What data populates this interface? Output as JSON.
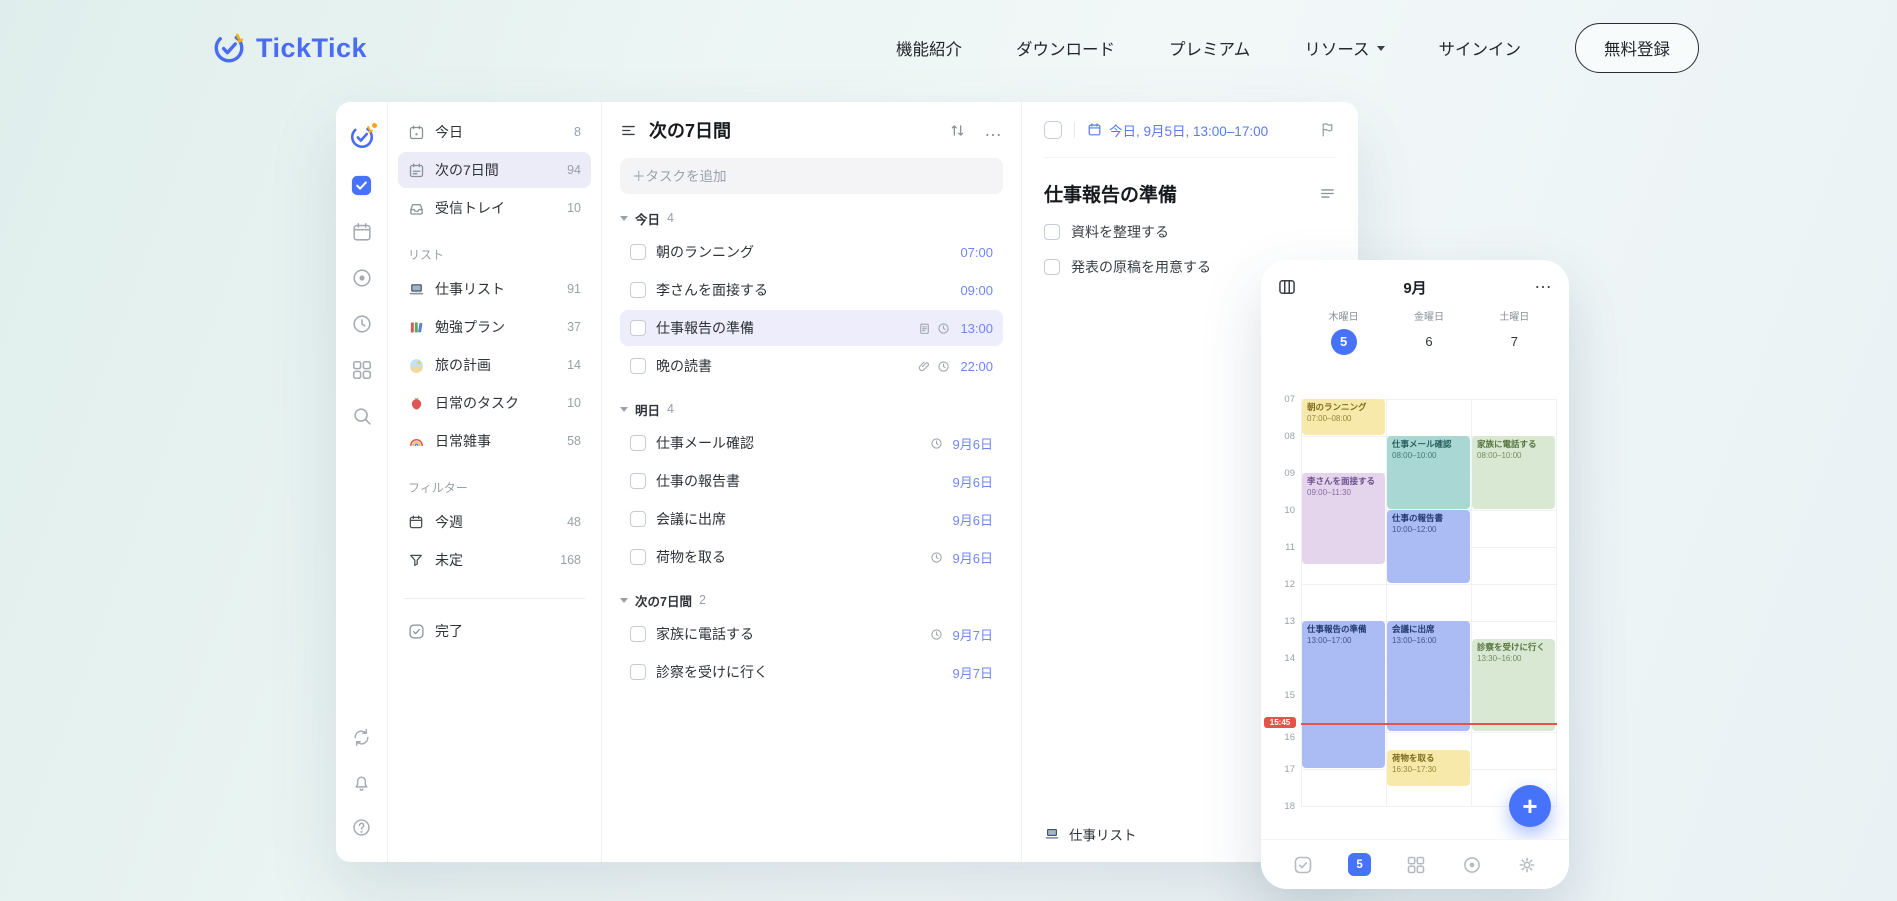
{
  "brand": {
    "name": "TickTick"
  },
  "nav": {
    "items": [
      {
        "label": "機能紹介"
      },
      {
        "label": "ダウンロード"
      },
      {
        "label": "プレミアム"
      },
      {
        "label": "リソース"
      },
      {
        "label": "サインイン"
      }
    ],
    "cta": "無料登録"
  },
  "icons": {
    "ellipsis": "…",
    "plus": "+"
  },
  "sidebar": {
    "smart_lists": [
      {
        "label": "今日",
        "count": "8"
      },
      {
        "label": "次の7日間",
        "count": "94"
      },
      {
        "label": "受信トレイ",
        "count": "10"
      }
    ],
    "lists_header": "リスト",
    "lists": [
      {
        "label": "仕事リスト",
        "count": "91"
      },
      {
        "label": "勉強プラン",
        "count": "37"
      },
      {
        "label": "旅の計画",
        "count": "14"
      },
      {
        "label": "日常のタスク",
        "count": "10"
      },
      {
        "label": "日常雑事",
        "count": "58"
      }
    ],
    "filters_header": "フィルター",
    "filters": [
      {
        "label": "今週",
        "count": "48"
      },
      {
        "label": "未定",
        "count": "168"
      }
    ],
    "completed_label": "完了"
  },
  "tasklist": {
    "title": "次の7日間",
    "add_placeholder": "＋タスクを追加",
    "groups": [
      {
        "label": "今日",
        "count": "4",
        "items": [
          {
            "title": "朝のランニング",
            "time": "07:00"
          },
          {
            "title": "李さんを面接する",
            "time": "09:00"
          },
          {
            "title": "仕事報告の準備",
            "time": "13:00"
          },
          {
            "title": "晩の読書",
            "time": "22:00"
          }
        ]
      },
      {
        "label": "明日",
        "count": "4",
        "items": [
          {
            "title": "仕事メール確認",
            "time": "9月6日"
          },
          {
            "title": "仕事の報告書",
            "time": "9月6日"
          },
          {
            "title": "会議に出席",
            "time": "9月6日"
          },
          {
            "title": "荷物を取る",
            "time": "9月6日"
          }
        ]
      },
      {
        "label": "次の7日間",
        "count": "2",
        "items": [
          {
            "title": "家族に電話する",
            "time": "9月7日"
          },
          {
            "title": "診察を受けに行く",
            "time": "9月7日"
          }
        ]
      }
    ]
  },
  "detail": {
    "date_label": "今日, 9月5日, 13:00–17:00",
    "title": "仕事報告の準備",
    "subtasks": [
      {
        "label": "資料を整理する"
      },
      {
        "label": "発表の原稿を用意する"
      }
    ],
    "list_label": "仕事リスト"
  },
  "phone": {
    "month": "9月",
    "days": [
      {
        "weekday": "木曜日",
        "date": "5"
      },
      {
        "weekday": "金曜日",
        "date": "6"
      },
      {
        "weekday": "土曜日",
        "date": "7"
      }
    ],
    "hours": [
      "07",
      "08",
      "09",
      "10",
      "11",
      "12",
      "13",
      "14",
      "15",
      "16",
      "17",
      "18"
    ],
    "now": "15:45",
    "tab_day": "5",
    "events": [
      {
        "title": "朝のランニング",
        "time": "07:00–08:00",
        "day": "木曜日"
      },
      {
        "title": "仕事メール確認",
        "time": "08:00–10:00",
        "day": "金曜日"
      },
      {
        "title": "家族に電話する",
        "time": "08:00–10:00",
        "day": "土曜日"
      },
      {
        "title": "李さんを面接する",
        "time": "09:00–11:30",
        "day": "木曜日"
      },
      {
        "title": "仕事の報告書",
        "time": "10:00–12:00",
        "day": "金曜日"
      },
      {
        "title": "仕事報告の準備",
        "time": "13:00–17:00",
        "day": "木曜日"
      },
      {
        "title": "会議に出席",
        "time": "13:00–16:00",
        "day": "金曜日"
      },
      {
        "title": "診察を受けに行く",
        "time": "13:30–16:00",
        "day": "土曜日"
      },
      {
        "title": "荷物を取る",
        "time": "16:30–17:30",
        "day": "金曜日"
      }
    ]
  },
  "colors": {
    "brand_blue": "#4772FA",
    "time_text_blue": "#6F86F6",
    "now_line_red": "#E5544B",
    "event_yellow": "#F7E9A9",
    "event_teal": "#A9D7D3",
    "event_green": "#D9E8D2",
    "event_purple": "#E5D5EC",
    "event_blue": "#ABBCF4",
    "selected_row_bg": "#EDEDFB"
  }
}
